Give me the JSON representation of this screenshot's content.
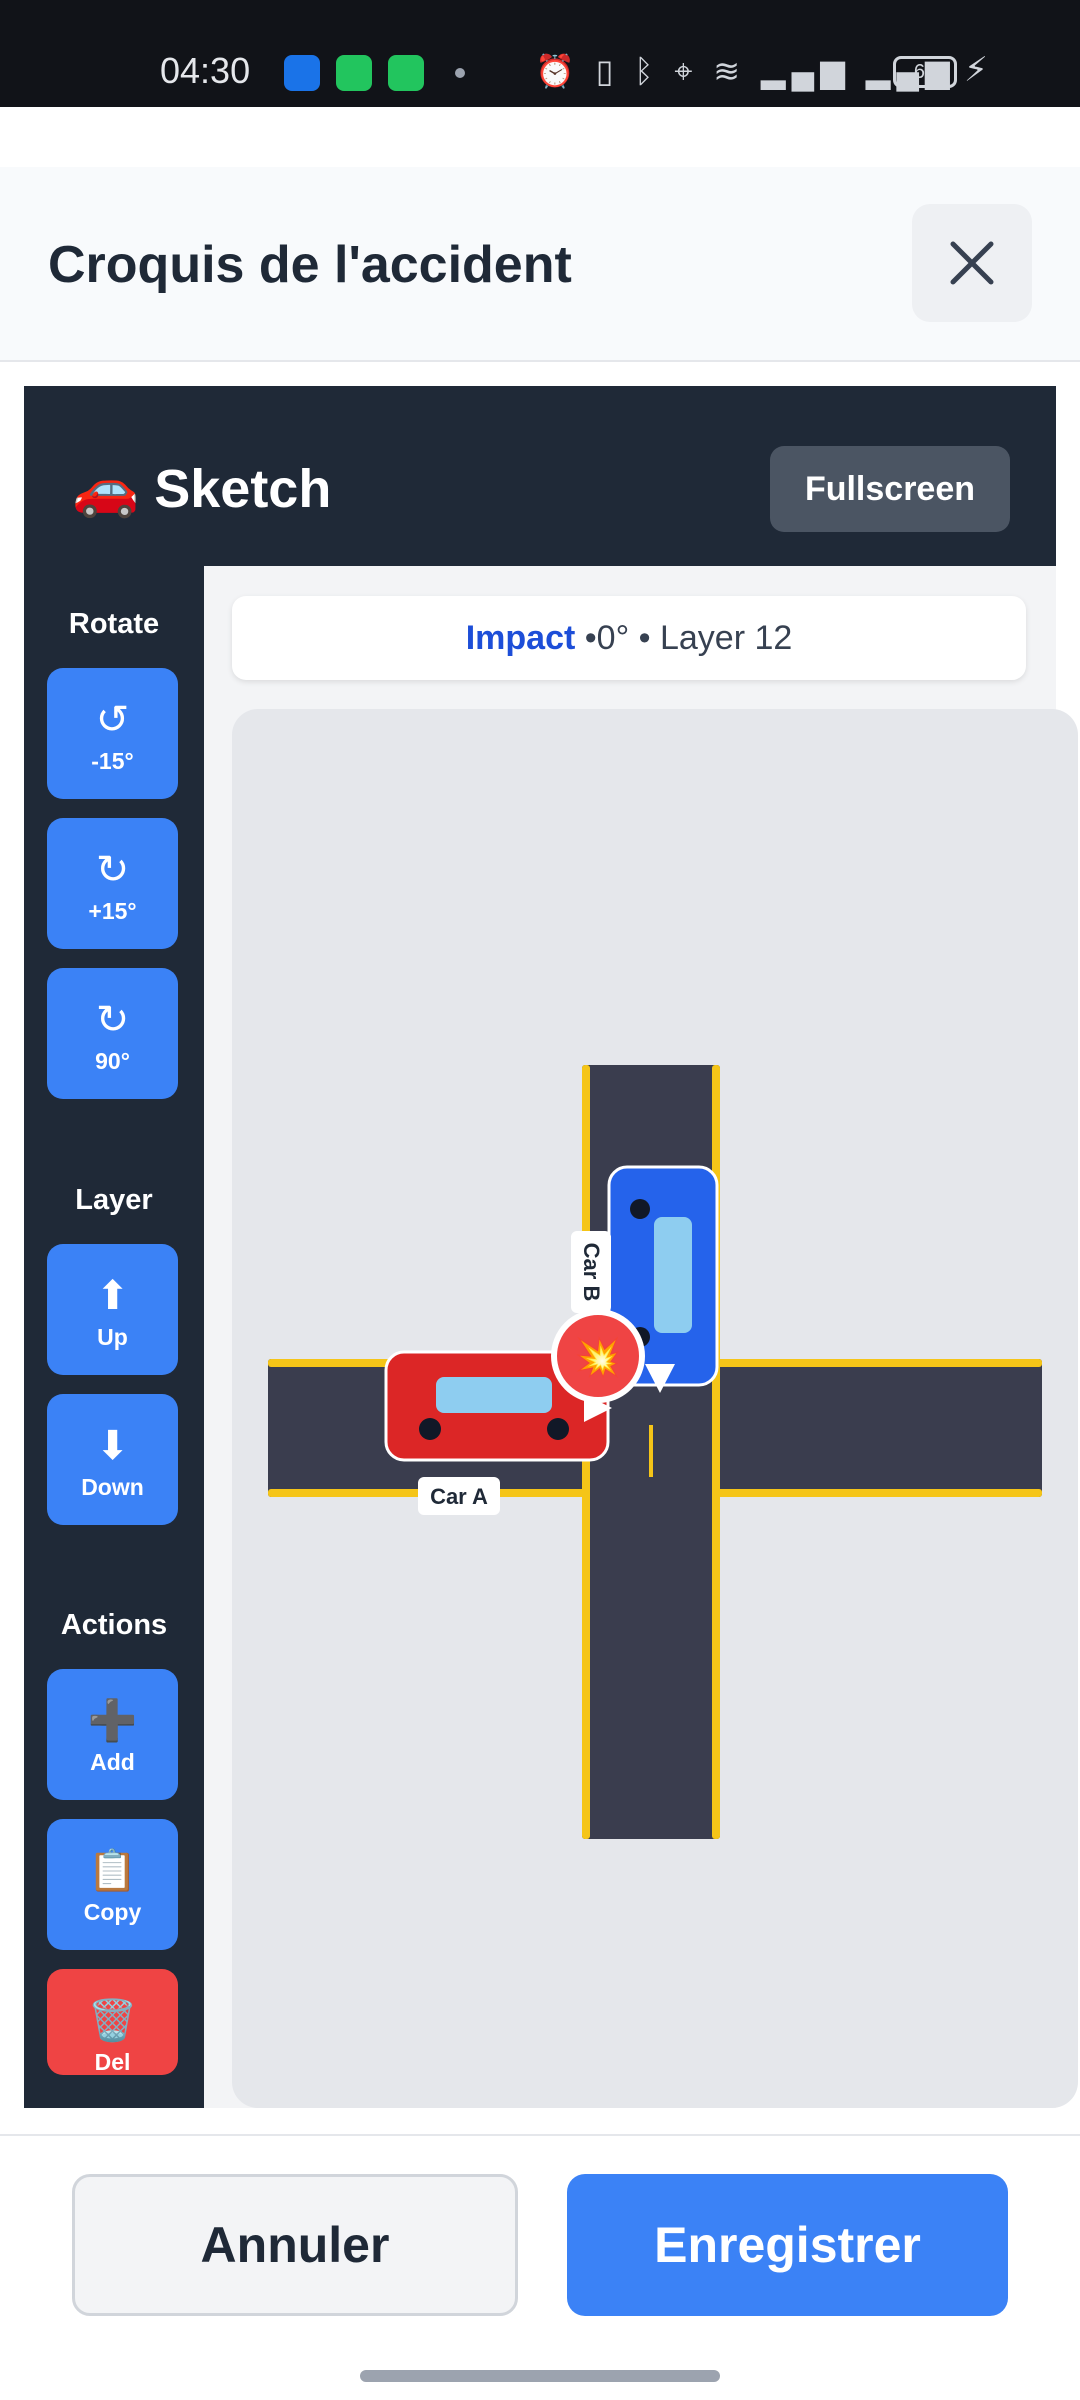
{
  "status_bar": {
    "time": "04:30",
    "battery": "65",
    "icons": [
      "android-icon",
      "upload-icon",
      "battery-saver-icon",
      "alarm-icon",
      "vibrate-icon",
      "bluetooth-icon",
      "location-icon",
      "wifi-icon",
      "signal-icon",
      "signal-icon",
      "battery-icon",
      "charging-icon"
    ]
  },
  "modal": {
    "title": "Croquis de l'accident"
  },
  "editor": {
    "title": "🚗 Sketch",
    "fullscreen_label": "Fullscreen"
  },
  "tools": {
    "rotate_label": "Rotate",
    "rotate_buttons": [
      {
        "icon": "↺",
        "label": "-15°"
      },
      {
        "icon": "↻",
        "label": "+15°"
      },
      {
        "icon": "↻",
        "label": "90°"
      }
    ],
    "layer_label": "Layer",
    "layer_buttons": [
      {
        "icon": "⬆",
        "label": "Up"
      },
      {
        "icon": "⬇",
        "label": "Down"
      }
    ],
    "actions_label": "Actions",
    "action_buttons": [
      {
        "icon": "➕",
        "label": "Add"
      },
      {
        "icon": "📋",
        "label": "Copy"
      },
      {
        "icon": "🗑️",
        "label": "Del"
      }
    ]
  },
  "info_bar": {
    "selected": "Impact",
    "details": " •0° • Layer 12"
  },
  "scene": {
    "car_a_label": "Car A",
    "car_b_label": "Car B",
    "impact_icon": "💥",
    "colors": {
      "road": "#3a3d4e",
      "road_edge": "#f5c518",
      "car_a": "#dc2626",
      "car_b": "#2563eb",
      "window": "#8ecdf0",
      "impact": "#ef4444"
    }
  },
  "footer": {
    "cancel_label": "Annuler",
    "save_label": "Enregistrer"
  }
}
